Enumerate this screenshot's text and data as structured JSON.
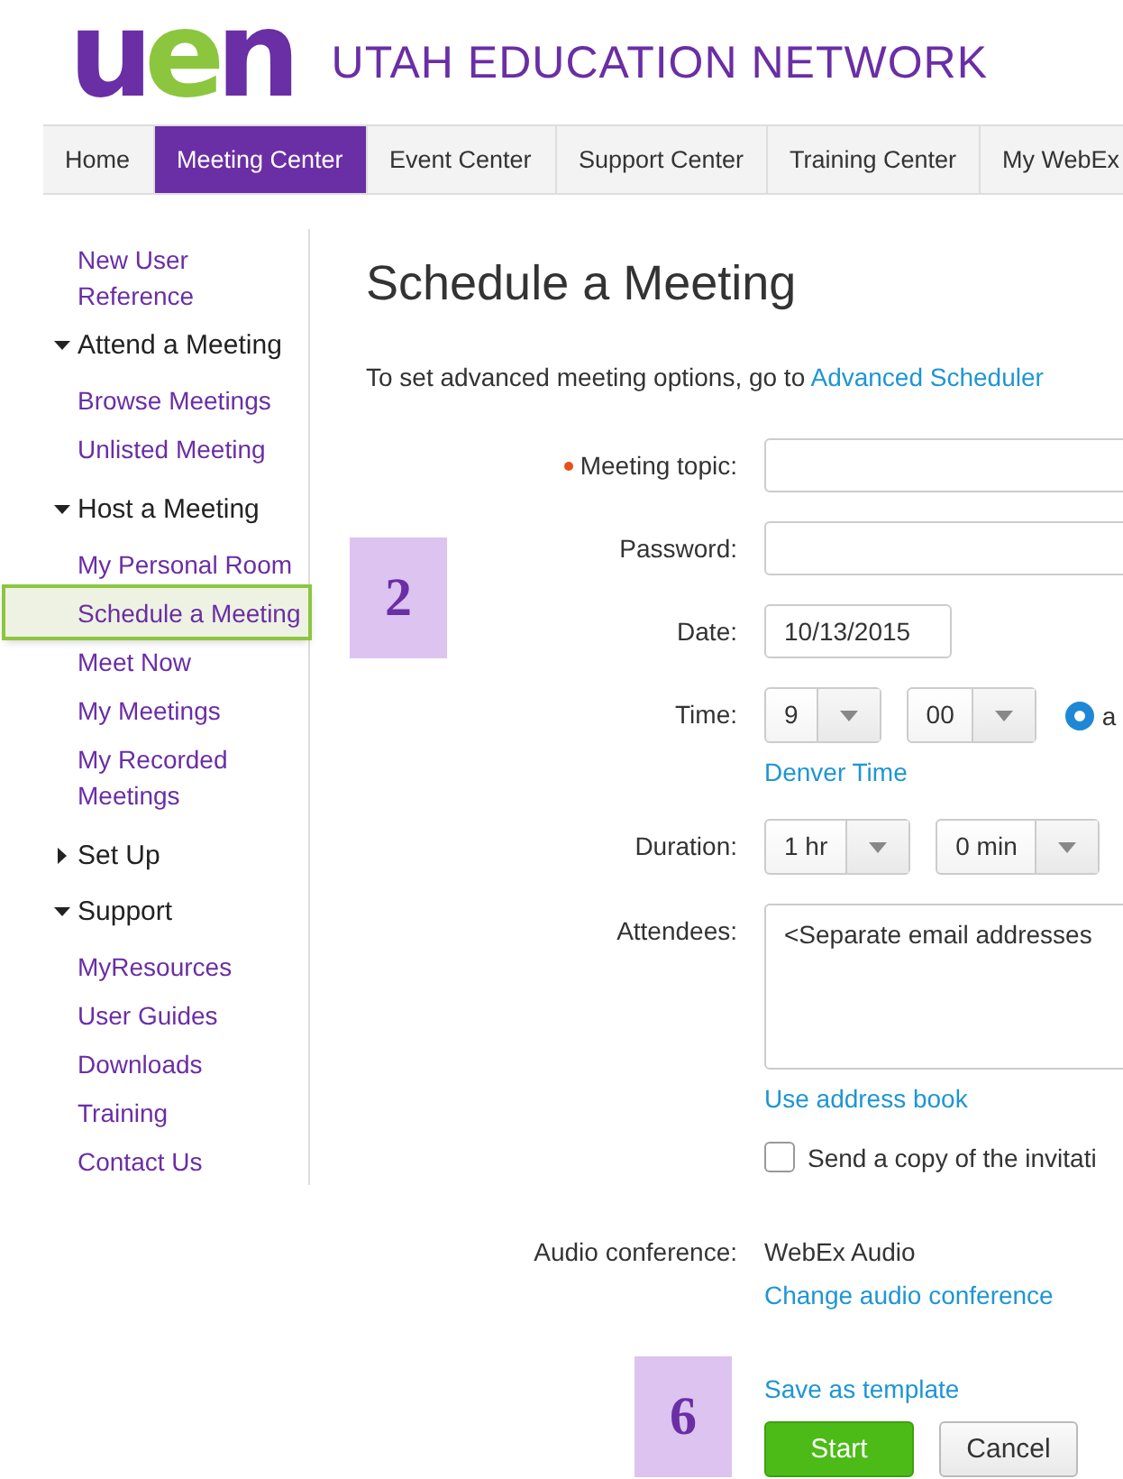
{
  "logo": {
    "letters": [
      {
        "text": "u",
        "color": "#6a2ea5"
      },
      {
        "text": "e",
        "color": "#8cc63f"
      },
      {
        "text": "n",
        "color": "#6a2ea5"
      }
    ],
    "title": "UTAH EDUCATION NETWORK"
  },
  "nav": [
    {
      "label": "Home",
      "selected": false
    },
    {
      "label": "Meeting Center",
      "selected": true
    },
    {
      "label": "Event Center",
      "selected": false
    },
    {
      "label": "Support Center",
      "selected": false
    },
    {
      "label": "Training Center",
      "selected": false
    },
    {
      "label": "My WebEx",
      "selected": false
    }
  ],
  "sidebar": [
    {
      "kind": "link",
      "label": "New User Reference",
      "selected": false
    },
    {
      "kind": "group",
      "label": "Attend a Meeting",
      "expanded": true,
      "children": [
        {
          "label": "Browse Meetings",
          "selected": false
        },
        {
          "label": "Unlisted Meeting",
          "selected": false
        }
      ]
    },
    {
      "kind": "group",
      "label": "Host a Meeting",
      "expanded": true,
      "children": [
        {
          "label": "My Personal Room",
          "selected": false
        },
        {
          "label": "Schedule a Meeting",
          "selected": true
        },
        {
          "label": "Meet Now",
          "selected": false
        },
        {
          "label": "My Meetings",
          "selected": false
        },
        {
          "label": "My Recorded Meetings",
          "selected": false
        }
      ]
    },
    {
      "kind": "group",
      "label": "Set Up",
      "expanded": false
    },
    {
      "kind": "group",
      "label": "Support",
      "expanded": true,
      "children": [
        {
          "label": "MyResources",
          "selected": false
        },
        {
          "label": "User Guides",
          "selected": false
        },
        {
          "label": "Downloads",
          "selected": false
        },
        {
          "label": "Training",
          "selected": false
        },
        {
          "label": "Contact Us",
          "selected": false
        }
      ]
    }
  ],
  "main": {
    "title": "Schedule a Meeting",
    "intro": "To set advanced meeting options, go to",
    "intro_link": "Advanced Scheduler",
    "fields": [
      {
        "kind": "text",
        "label": "Meeting topic:",
        "required": true
      },
      {
        "kind": "text",
        "label": "Password:",
        "required": false
      },
      {
        "kind": "date",
        "label": "Date:",
        "value": "10/13/2015"
      },
      {
        "kind": "time",
        "label": "Time:",
        "hour": "9",
        "minute": "00",
        "radio": {
          "label": "a",
          "selected": true
        },
        "link": "Denver Time"
      },
      {
        "kind": "duration",
        "label": "Duration:",
        "hours": "1 hr",
        "minutes": "0 min"
      },
      {
        "kind": "attendees",
        "label": "Attendees:",
        "value": "<Separate email addresses",
        "link": "Use address book",
        "copy": {
          "label": "Send a copy of the invitati",
          "checked": false
        }
      },
      {
        "kind": "audio",
        "label": "Audio conference:",
        "value": "WebEx Audio",
        "link": "Change audio conference"
      }
    ],
    "save_link": "Save as template",
    "buttons": [
      {
        "label": "Start",
        "kind": "primary"
      },
      {
        "label": "Cancel",
        "kind": "secondary"
      }
    ]
  },
  "callouts": [
    {
      "text": "2"
    },
    {
      "text": "6"
    }
  ]
}
